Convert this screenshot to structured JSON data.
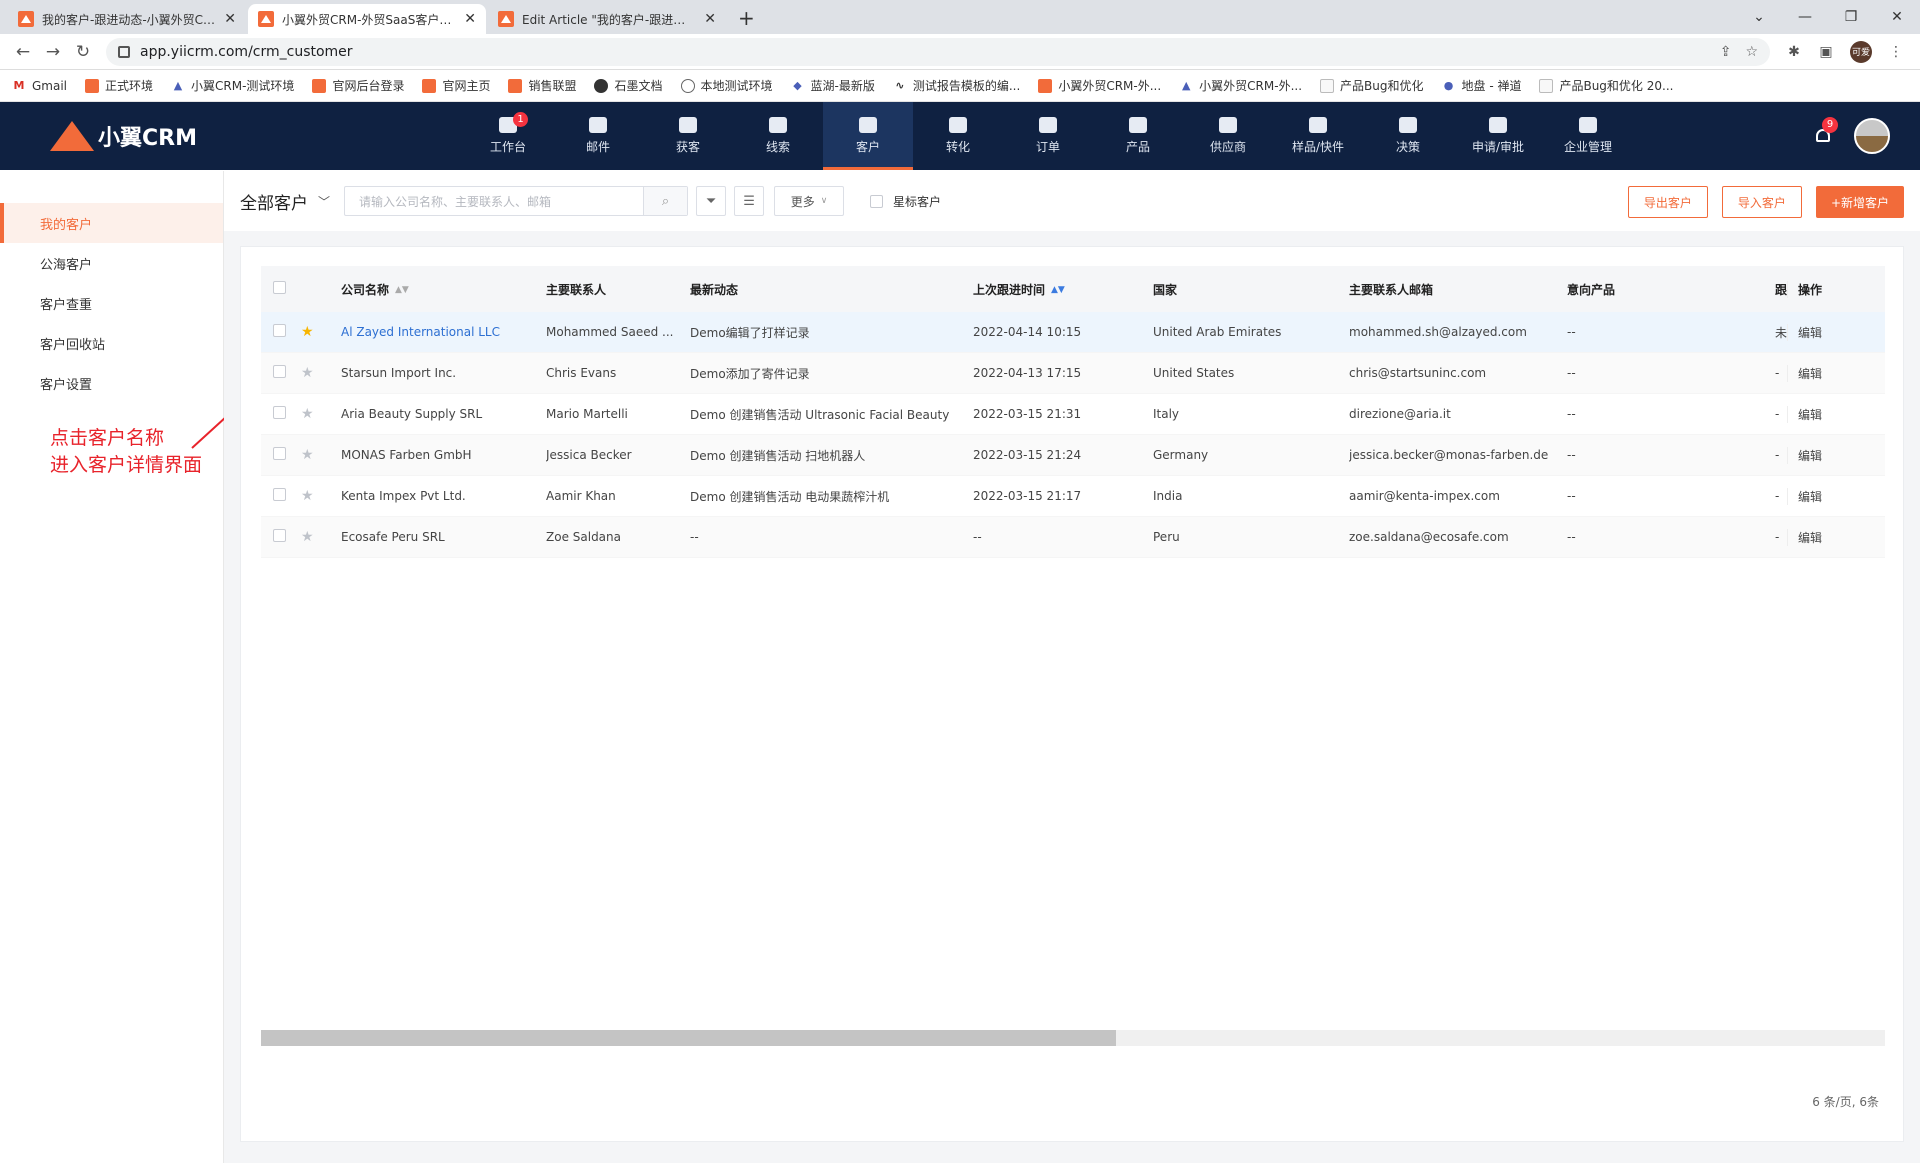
{
  "browser": {
    "tabs": [
      {
        "title": "我的客户-跟进动态-小翼外贸CRM"
      },
      {
        "title": "小翼外贸CRM-外贸SaaS客户管理"
      },
      {
        "title": "Edit Article \"我的客户-跟进动态"
      }
    ],
    "url": "app.yiicrm.com/crm_customer",
    "profile_label": "可爱",
    "bookmarks": [
      {
        "label": "Gmail",
        "icon": "gmail-icon"
      },
      {
        "label": "正式环境",
        "icon": "xiaoyi-icon"
      },
      {
        "label": "小翼CRM-测试环境",
        "icon": "triangle-icon"
      },
      {
        "label": "官网后台登录",
        "icon": "xiaoyi-icon"
      },
      {
        "label": "官网主页",
        "icon": "xiaoyi-icon"
      },
      {
        "label": "销售联盟",
        "icon": "xiaoyi-icon"
      },
      {
        "label": "石墨文档",
        "icon": "shimo-icon"
      },
      {
        "label": "本地测试环境",
        "icon": "globe-icon"
      },
      {
        "label": "蓝湖-最新版",
        "icon": "lanhu-icon"
      },
      {
        "label": "测试报告模板的编...",
        "icon": "link-icon"
      },
      {
        "label": "小翼外贸CRM-外...",
        "icon": "xiaoyi-icon"
      },
      {
        "label": "小翼外贸CRM-外...",
        "icon": "triangle-icon"
      },
      {
        "label": "产品Bug和优化",
        "icon": "doc-icon"
      },
      {
        "label": "地盘 - 禅道",
        "icon": "zentao-icon"
      },
      {
        "label": "产品Bug和优化 20...",
        "icon": "doc-icon"
      }
    ]
  },
  "app": {
    "logo_text": "小翼CRM",
    "nav": [
      {
        "label": "工作台",
        "badge": "1"
      },
      {
        "label": "邮件"
      },
      {
        "label": "获客"
      },
      {
        "label": "线索"
      },
      {
        "label": "客户",
        "active": true
      },
      {
        "label": "转化"
      },
      {
        "label": "订单"
      },
      {
        "label": "产品"
      },
      {
        "label": "供应商"
      },
      {
        "label": "样品/快件"
      },
      {
        "label": "决策"
      },
      {
        "label": "申请/审批"
      },
      {
        "label": "企业管理"
      }
    ],
    "notif_count": "9"
  },
  "sidebar": {
    "items": [
      {
        "label": "我的客户",
        "active": true
      },
      {
        "label": "公海客户"
      },
      {
        "label": "客户查重"
      },
      {
        "label": "客户回收站"
      },
      {
        "label": "客户设置"
      }
    ]
  },
  "annotation": {
    "line1": "点击客户名称",
    "line2": "进入客户详情界面"
  },
  "toolbar": {
    "scope": "全部客户",
    "search_placeholder": "请输入公司名称、主要联系人、邮箱",
    "more_label": "更多",
    "star_filter": "星标客户",
    "export_label": "导出客户",
    "import_label": "导入客户",
    "add_label": "+新增客户"
  },
  "table": {
    "headers": {
      "company": "公司名称",
      "contact": "主要联系人",
      "activity": "最新动态",
      "last_follow": "上次跟进时间",
      "country": "国家",
      "email": "主要联系人邮箱",
      "product": "意向产品",
      "extra": "跟",
      "ops": "操作"
    },
    "rows": [
      {
        "starred": true,
        "company": "Al Zayed International LLC",
        "contact": "Mohammed Saeed ...",
        "activity": "Demo编辑了打样记录",
        "time": "2022-04-14 10:15",
        "country": "United Arab Emirates",
        "email": "mohammed.sh@alzayed.com",
        "product": "--",
        "extra": "未",
        "op": "编辑"
      },
      {
        "starred": false,
        "company": "Starsun Import Inc.",
        "contact": "Chris Evans",
        "activity": "Demo添加了寄件记录",
        "time": "2022-04-13 17:15",
        "country": "United States",
        "email": "chris@startsuninc.com",
        "product": "--",
        "extra": "-",
        "op": "编辑"
      },
      {
        "starred": false,
        "company": "Aria Beauty Supply SRL",
        "contact": "Mario Martelli",
        "activity": "Demo 创建销售活动 Ultrasonic Facial Beauty",
        "time": "2022-03-15 21:31",
        "country": "Italy",
        "email": "direzione@aria.it",
        "product": "--",
        "extra": "-",
        "op": "编辑"
      },
      {
        "starred": false,
        "company": "MONAS Farben GmbH",
        "contact": "Jessica Becker",
        "activity": "Demo 创建销售活动 扫地机器人",
        "time": "2022-03-15 21:24",
        "country": "Germany",
        "email": "jessica.becker@monas-farben.de",
        "product": "--",
        "extra": "-",
        "op": "编辑"
      },
      {
        "starred": false,
        "company": "Kenta Impex Pvt Ltd.",
        "contact": "Aamir Khan",
        "activity": "Demo 创建销售活动 电动果蔬榨汁机",
        "time": "2022-03-15 21:17",
        "country": "India",
        "email": "aamir@kenta-impex.com",
        "product": "--",
        "extra": "-",
        "op": "编辑"
      },
      {
        "starred": false,
        "company": "Ecosafe Peru SRL",
        "contact": "Zoe Saldana",
        "activity": "--",
        "time": "--",
        "country": "Peru",
        "email": "zoe.saldana@ecosafe.com",
        "product": "--",
        "extra": "-",
        "op": "编辑"
      }
    ]
  },
  "pagination": {
    "text": "6 条/页,  6条"
  }
}
